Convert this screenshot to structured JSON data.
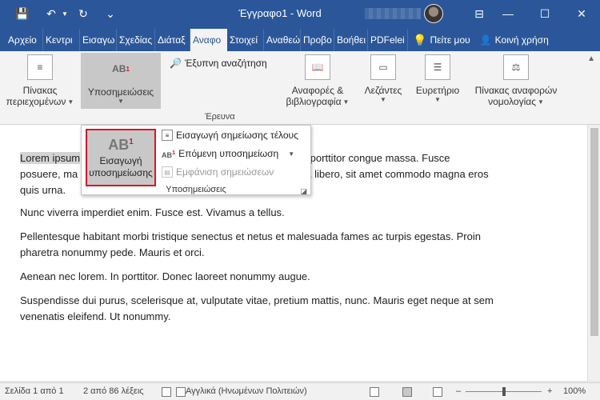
{
  "window": {
    "title": "Έγγραφο1 - Word",
    "buttons": [
      "—",
      "☐",
      "✕"
    ],
    "restore_label": "⊟"
  },
  "qat": {
    "save": "💾",
    "undo": "↶",
    "redo": "↻",
    "more": "⌄"
  },
  "tabs": [
    "Αρχείο",
    "Κεντρι",
    "Εισαγω",
    "Σχεδίας",
    "Διάταξ",
    "Αναφο",
    "Στοιχεί",
    "Αναθεώ",
    "Προβο",
    "Βοήθει",
    "PDFelei"
  ],
  "tab_extra": {
    "tell_me": "Πείτε μου",
    "share": "Κοινή χρήση"
  },
  "ribbon": {
    "toc": {
      "label1": "Πίνακας",
      "label2": "περιεχομένων"
    },
    "footnotes": {
      "icon_text": "AB",
      "label": "Υποσημειώσεις"
    },
    "smart_lookup": "Έξυπνη αναζήτηση",
    "research_group": "Έρευνα",
    "citations": {
      "label1": "Αναφορές &",
      "label2": "βιβλιογραφία"
    },
    "captions": {
      "label": "Λεζάντες"
    },
    "index": {
      "label": "Ευρετήριο"
    },
    "authorities": {
      "label1": "Πίνακας αναφορών",
      "label2": "νομολογίας"
    }
  },
  "dropdown": {
    "big_button": {
      "icon_text": "AB",
      "sup": "1",
      "label1": "Εισαγωγή",
      "label2": "υποσημείωσης"
    },
    "items": [
      {
        "label": "Εισαγωγή σημείωσης τέλους",
        "enabled": true
      },
      {
        "label": "Επόμενη υποσημείωση",
        "enabled": true
      },
      {
        "label": "Εμφάνιση σημειώσεων",
        "enabled": false
      }
    ],
    "footer": "Υποσημειώσεις"
  },
  "document": {
    "paragraphs": [
      {
        "prefix_highlight": "Lorem ipsum",
        "line1_rest": "ecenas porttitor congue massa. Fusce",
        "line2_left": "posuere, ma",
        "line2_right": "a libero, sit amet commodo magna eros",
        "line3": "quis urna."
      },
      {
        "text": "Nunc viverra imperdiet enim. Fusce est. Vivamus a tellus."
      },
      {
        "text1": "Pellentesque habitant morbi tristique senectus et netus et malesuada fames ac turpis egestas. Proin",
        "text2": "pharetra nonummy pede. Mauris et orci."
      },
      {
        "text": "Aenean nec lorem. In porttitor. Donec laoreet nonummy augue."
      },
      {
        "text1": "Suspendisse dui purus, scelerisque at, vulputate vitae, pretium mattis, nunc. Mauris eget neque at sem",
        "text2": "venenatis eleifend. Ut nonummy."
      }
    ]
  },
  "status": {
    "page": "Σελίδα 1 από 1",
    "words": "2 από 86 λέξεις",
    "language": "Αγγλικά (Ηνωμένων Πολιτειών)",
    "zoom_minus": "–",
    "zoom_plus": "+",
    "zoom": "100%"
  }
}
